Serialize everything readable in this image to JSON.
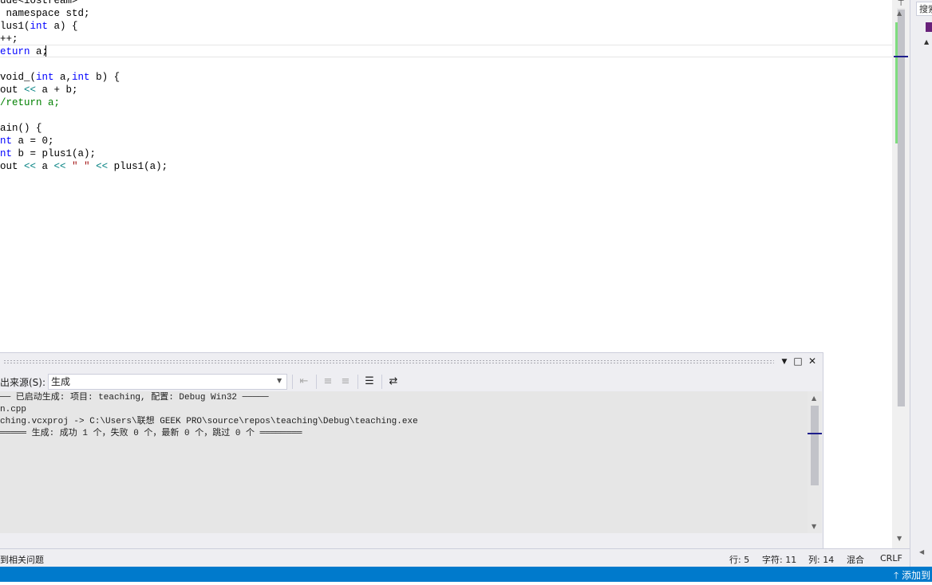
{
  "editor": {
    "lines": [
      [
        {
          "t": "ude<iostream>",
          "c": ""
        }
      ],
      [
        {
          "t": " namespace std;",
          "c": ""
        }
      ],
      [
        {
          "t": "lus1(",
          "c": ""
        },
        {
          "t": "int",
          "c": "kw"
        },
        {
          "t": " a) {",
          "c": ""
        }
      ],
      [
        {
          "t": "++;",
          "c": ""
        }
      ],
      [
        {
          "t": "eturn",
          "c": "kw"
        },
        {
          "t": " a;",
          "c": ""
        }
      ],
      [
        {
          "t": "",
          "c": ""
        }
      ],
      [
        {
          "t": "void_(",
          "c": ""
        },
        {
          "t": "int",
          "c": "kw"
        },
        {
          "t": " a,",
          "c": ""
        },
        {
          "t": "int",
          "c": "kw"
        },
        {
          "t": " b) {",
          "c": ""
        }
      ],
      [
        {
          "t": "out ",
          "c": ""
        },
        {
          "t": "<<",
          "c": "op"
        },
        {
          "t": " a + b;",
          "c": ""
        }
      ],
      [
        {
          "t": "/return a;",
          "c": "cm"
        }
      ],
      [
        {
          "t": "",
          "c": ""
        }
      ],
      [
        {
          "t": "ain() {",
          "c": ""
        }
      ],
      [
        {
          "t": "nt",
          "c": "kw"
        },
        {
          "t": " a = 0;",
          "c": ""
        }
      ],
      [
        {
          "t": "nt",
          "c": "kw"
        },
        {
          "t": " b = plus1(a);",
          "c": ""
        }
      ],
      [
        {
          "t": "out ",
          "c": ""
        },
        {
          "t": "<<",
          "c": "op"
        },
        {
          "t": " a ",
          "c": ""
        },
        {
          "t": "<<",
          "c": "op"
        },
        {
          "t": " ",
          "c": ""
        },
        {
          "t": "\" \"",
          "c": "str"
        },
        {
          "t": " ",
          "c": ""
        },
        {
          "t": "<<",
          "c": "op"
        },
        {
          "t": " plus1(a);",
          "c": ""
        }
      ]
    ]
  },
  "search": {
    "placeholder": "搜索"
  },
  "output": {
    "source_label": "出来源(S):",
    "source_value": "生成",
    "lines": [
      "── 已启动生成: 项目: teaching, 配置: Debug Win32 ─────",
      "n.cpp",
      "ching.vcxproj -> C:\\Users\\联想 GEEK PRO\\source\\repos\\teaching\\Debug\\teaching.exe",
      "═════ 生成: 成功 1 个，失败 0 个，最新 0 个，跳过 0 个 ════════"
    ]
  },
  "status": {
    "issues": "到相关问题",
    "row": "行: 5",
    "char": "字符: 11",
    "col": "列: 14",
    "mode": "混合",
    "eol": "CRLF"
  },
  "bottom": {
    "add_source": "添加到"
  },
  "colors": {
    "accent": "#007acc",
    "keyword": "#0000ff",
    "comment": "#008000",
    "string": "#a31515"
  }
}
